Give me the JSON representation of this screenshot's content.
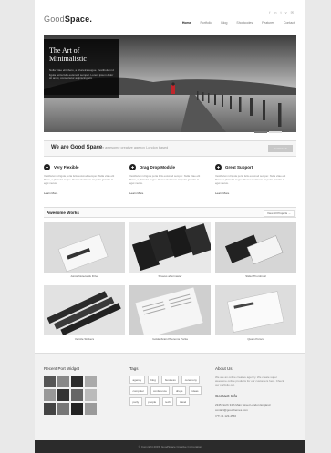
{
  "header": {
    "logo_main": "Good",
    "logo_bold": "Space.",
    "social": [
      "f",
      "in",
      "t",
      "v",
      "✉"
    ],
    "nav": [
      "Home",
      "Portfolio",
      "Blog",
      "Shortcodes",
      "Features",
      "Contact"
    ]
  },
  "slider": {
    "title": "The Art of Minimalistic",
    "text": "Nulla vitae elit libero, a pharetra augue. Vestibulum id ligula porta felis euismod semper. Lorem ipsum dolor sit amet, consectetur adipiscing elit."
  },
  "tagline": {
    "title": "We are Good Space",
    "subtitle": "Super awesome creative agency London based",
    "button": "Contact Us"
  },
  "features": [
    {
      "title": "Very Flexible",
      "icon": "✚",
      "text": "Vestibulum id ligula porta felis euismod semper. Nulla vitae elit libero, a pharetra augue. Donec id elit non mi porta gravida at eget metus.",
      "link": "Learn More"
    },
    {
      "title": "Drag Drop Module",
      "icon": "✚",
      "text": "Vestibulum id ligula porta felis euismod semper. Nulla vitae elit libero, a pharetra augue. Donec id elit non mi porta gravida at eget metus.",
      "link": "Learn More"
    },
    {
      "title": "Great Support",
      "icon": "✚",
      "text": "Vestibulum id ligula porta felis euismod semper. Nulla vitae elit libero, a pharetra augue. Donec id elit non mi porta gravida at eget metus.",
      "link": "Learn More"
    }
  ],
  "works": {
    "title": "Awesome Works",
    "view_all": "View All Projects →",
    "items": [
      {
        "caption": "Junior Notecards Drive"
      },
      {
        "caption": "Shaves aftermaster"
      },
      {
        "caption": "Slider Thumbnail"
      },
      {
        "caption": "Vehicle Stickers"
      },
      {
        "caption": "Goldenbrain Phenoms Portia"
      },
      {
        "caption": "Quam Porsco"
      }
    ]
  },
  "footer": {
    "recent_title": "Recent Port Widget",
    "tags_title": "Tags",
    "tags": [
      "agency",
      "blog",
      "business",
      "ceremony",
      "computer",
      "conference",
      "drugs",
      "ideas",
      "party",
      "people",
      "tech",
      "travel"
    ],
    "about_title": "About Us",
    "about_text": "We are an online creative agency. We create super awesome online products for our customers here. Check our portfolio out.",
    "contact_title": "Contact Info",
    "contact": [
      "2345 North 34th Main Street London England",
      "contact@goodthemes.com",
      "(77) 71 123-4566"
    ]
  },
  "copyright": "© Copyright 2015, GoodSpace Creative Corporation"
}
